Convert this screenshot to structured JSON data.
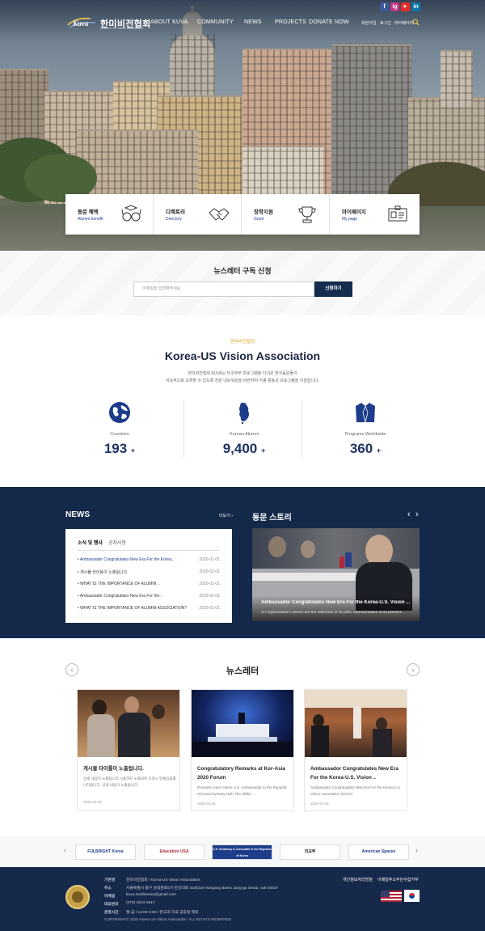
{
  "header": {
    "logo_text": "Kuva",
    "org_name": "한미비전협회",
    "org_sub": "Korea-U.S. Vision Association",
    "nav": [
      "ABOUT KUVA",
      "COMMUNITY",
      "NEWS",
      "PROJECTS",
      "DONATE NOW"
    ],
    "util": [
      "회원가입",
      "로그인",
      "마이페이지"
    ],
    "social": [
      "f",
      "ig",
      "▶",
      "in"
    ]
  },
  "quick_menu": [
    {
      "title": "동문 혜택",
      "sub": "Alumni benefit",
      "icon": "glasses-icon"
    },
    {
      "title": "디렉토리",
      "sub": "Directory",
      "icon": "handshake-icon"
    },
    {
      "title": "장학지원",
      "sub": "Grant",
      "icon": "trophy-icon"
    },
    {
      "title": "마이페이지",
      "sub": "My page",
      "icon": "id-card-icon"
    }
  ],
  "subscribe": {
    "title": "뉴스레터 구독 신청",
    "placeholder": "이메일을 입력해주세요.",
    "button": "신청하기"
  },
  "about": {
    "kicker": "한미비전협회",
    "title": "Korea-US Vision Association",
    "desc1": "한미비전협회 KUVA는 미국무부 프로그램을 다녀온 한국동문들이",
    "desc2": "지속적으로 교류할 수 있도록 전문 네트워킹을 마련하여 각종 활동과 프로그램을 지원합니다.",
    "stats": [
      {
        "label": "Countries",
        "value": "193",
        "icon": "globe-icon"
      },
      {
        "label": "Korean Alumni",
        "value": "9,400",
        "icon": "korea-map-icon"
      },
      {
        "label": "Programs Worldwide",
        "value": "360",
        "icon": "jacket-icon"
      }
    ],
    "plus": "+"
  },
  "news": {
    "title": "NEWS",
    "more": "더보기 ›",
    "tabs": [
      "소식 및 행사",
      "공지사항"
    ],
    "items": [
      {
        "title": "Ambassador Congratulates New Era For the Korea..",
        "date": "2020-01-01"
      },
      {
        "title": "게시물 타이틀이 노출됩니다.",
        "date": "2020-01-01"
      },
      {
        "title": "WHAT IS THE IMPORTANCE OF ALUMNI ..",
        "date": "2020-01-01"
      },
      {
        "title": "Ambassador Congratulates New Era For the ..",
        "date": "2020-01-01"
      },
      {
        "title": "WHAT IS THE IMPORTANCE OF ALUMNI ASSOCIATION?",
        "date": "2020-01-01"
      }
    ]
  },
  "story": {
    "title": "동문 스토리",
    "prev": "‹",
    "next": "›",
    "headline": "Ambassador Congratulates New Era For the Korea-U.S. Vision ...",
    "summary": "An organization's alumni are the reflection of its past, representation of its present..."
  },
  "newsletter": {
    "title": "뉴스레터",
    "prev": "‹",
    "next": "›",
    "cards": [
      {
        "title": "게시물 타이틀이 노출됩니다.",
        "summary": "상세 내용이 노출됩니다. 2줄까지 노출되며 초과시 말줄임표를 나타냅니다. 상세 내용이 노출됩니다.",
        "date": "2020-01-01"
      },
      {
        "title": "Congratulatory Remarks at Kor-Asia 2020 Forum",
        "summary": "Remarks Harry Harris U.S. Ambassador to the Republic of Korea Dynasty Hall, The Shilla ...",
        "date": "2020-01-01"
      },
      {
        "title": "Ambassador Congratulates New Era For the Korea-U.S. Vision ..",
        "summary": "Ambassador Congratulates New Era For the Korea-U.S. Vision Association (KUVA)",
        "date": "2020-01-01"
      }
    ]
  },
  "partners": {
    "prev": "‹",
    "next": "›",
    "items": [
      "FULBRIGHT Korea",
      "Education USA",
      "U.S. Embassy & Consulate in the Republic of Korea",
      "외교부",
      "American Spaces"
    ]
  },
  "footer": {
    "rows": [
      {
        "k": "기관명",
        "v": "한미비전협회 / Korea-US Vision Association"
      },
      {
        "k": "주소",
        "v": "서울특별시 중구 남대문로5가 한강대로 416(416 Hangang-daero Jung-gu Seoul, null 04637"
      },
      {
        "k": "이메일",
        "v": "kuva.southkorea@gmail.com"
      },
      {
        "k": "대표번호",
        "v": "(070) 4513-1517"
      },
      {
        "k": "운영시간",
        "v": "월-금 / 10:00-4:00 / 한국과 미국 공휴일 제외"
      }
    ],
    "copyright": "COPYRIGHT© 2020 Korea-US Vision Association. ALL RIGHTS RESERVED",
    "links": [
      "개인정보처리방침",
      "이메일주소무단수집거부"
    ]
  }
}
